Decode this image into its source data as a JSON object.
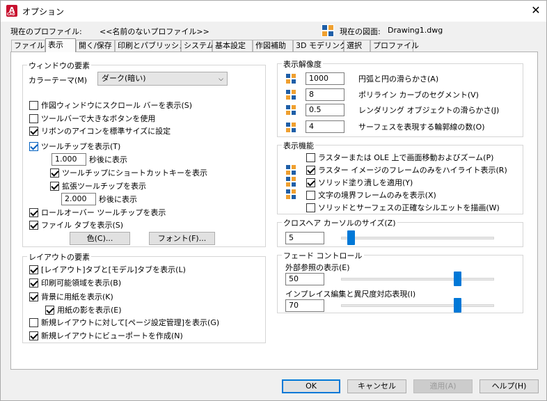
{
  "window": {
    "title": "オプション",
    "app_icon_letter": "A",
    "app_icon_sub": "CAD",
    "close_glyph": "✕"
  },
  "header": {
    "profile_label": "現在のプロファイル:",
    "profile_value": "<<名前のないプロファイル>>",
    "drawing_label": "現在の図面:",
    "drawing_value": "Drawing1.dwg"
  },
  "tabs": [
    "ファイル",
    "表示",
    "開く/保存",
    "印刷とパブリッシュ",
    "システム",
    "基本設定",
    "作図補助",
    "3D モデリング",
    "選択",
    "プロファイル"
  ],
  "window_elements": {
    "legend": "ウィンドウの要素",
    "color_theme_label": "カラーテーマ(M)",
    "color_theme_value": "ダーク(暗い)",
    "scrollbars": "作図ウィンドウにスクロール バーを表示(S)",
    "large_buttons": "ツールバーで大きなボタンを使用",
    "ribbon_icons": "リボンのアイコンを標準サイズに設定",
    "tooltips": "ツールチップを表示(T)",
    "tooltip_delay": "1.000",
    "seconds_after": "秒後に表示",
    "shortcut_keys": "ツールチップにショートカットキーを表示",
    "extended_tooltips": "拡張ツールチップを表示",
    "extended_delay": "2.000",
    "rollover": "ロールオーバー ツールチップを表示",
    "file_tabs": "ファイル タブを表示(S)",
    "colors_button": "色(C)...",
    "fonts_button": "フォント(F)..."
  },
  "layout_elements": {
    "legend": "レイアウトの要素",
    "layout_model_tabs": "[レイアウト]タブと[モデル]タブを表示(L)",
    "printable_area": "印刷可能領域を表示(B)",
    "paper_background": "背景に用紙を表示(K)",
    "paper_shadow": "用紙の影を表示(E)",
    "page_setup_manager": "新規レイアウトに対して[ページ設定管理]を表示(G)",
    "create_viewport": "新規レイアウトにビューポートを作成(N)"
  },
  "display_resolution": {
    "legend": "表示解像度",
    "rows": [
      {
        "value": "1000",
        "label": "円弧と円の滑らかさ(A)"
      },
      {
        "value": "8",
        "label": "ポリライン カーブのセグメント(V)"
      },
      {
        "value": "0.5",
        "label": "レンダリング オブジェクトの滑らかさ(J)"
      },
      {
        "value": "4",
        "label": "サーフェスを表現する輪郭線の数(O)"
      }
    ]
  },
  "display_performance": {
    "legend": "表示機能",
    "items": [
      {
        "label": "ラスターまたは OLE 上で画面移動およびズーム(P)",
        "checked": false
      },
      {
        "label": "ラスター イメージのフレームのみをハイライト表示(R)",
        "checked": true
      },
      {
        "label": "ソリッド塗り潰しを適用(Y)",
        "checked": true
      },
      {
        "label": "文字の境界フレームのみを表示(X)",
        "checked": false
      },
      {
        "label": "ソリッドとサーフェスの正確なシルエットを描画(W)",
        "checked": false
      }
    ]
  },
  "crosshair": {
    "legend": "クロスヘア カーソルのサイズ(Z)",
    "value": "5",
    "level_percent": 5
  },
  "fade": {
    "legend": "フェード コントロール",
    "xref_label": "外部参照の表示(E)",
    "xref_value": "50",
    "xref_level_percent": 50,
    "inplace_label": "インプレイス編集と異尺度対応表現(I)",
    "inplace_value": "70",
    "inplace_level_percent": 70
  },
  "footer": {
    "ok": "OK",
    "cancel": "キャンセル",
    "apply": "適用(A)",
    "help": "ヘルプ(H)"
  },
  "colors": {
    "accent": "#0078d7",
    "brand": "#c8102e"
  }
}
